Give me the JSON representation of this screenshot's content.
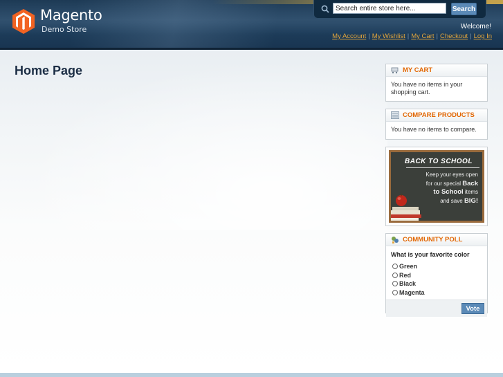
{
  "header": {
    "logo_title": "Magento",
    "logo_subtitle": "Demo Store",
    "search_placeholder": "Search entire store here...",
    "search_button": "Search",
    "welcome": "Welcome!",
    "links": [
      "My Account",
      "My Wishlist",
      "My Cart",
      "Checkout",
      "Log In"
    ]
  },
  "main": {
    "page_title": "Home Page"
  },
  "sidebar": {
    "cart": {
      "title": "MY CART",
      "body": "You have no items in your shopping cart.",
      "icon": "cart-icon"
    },
    "compare": {
      "title": "COMPARE PRODUCTS",
      "body": "You have no items to compare.",
      "icon": "compare-icon"
    },
    "promo": {
      "headline": "BACK TO SCHOOL",
      "line1": "Keep your eyes open",
      "line2": "for our special",
      "bold1": "Back",
      "bold2": "to School",
      "line3": "items",
      "line4": "and save",
      "bold3": "BIG!"
    },
    "poll": {
      "title": "COMMUNITY POLL",
      "icon": "poll-icon",
      "question": "What is your favorite color",
      "options": [
        "Green",
        "Red",
        "Black",
        "Magenta"
      ],
      "vote_button": "Vote"
    }
  },
  "colors": {
    "header_bg": "#1d3a55",
    "accent_orange": "#e26703",
    "link_gold": "#e2a53c",
    "button_blue": "#5b8ab7"
  }
}
